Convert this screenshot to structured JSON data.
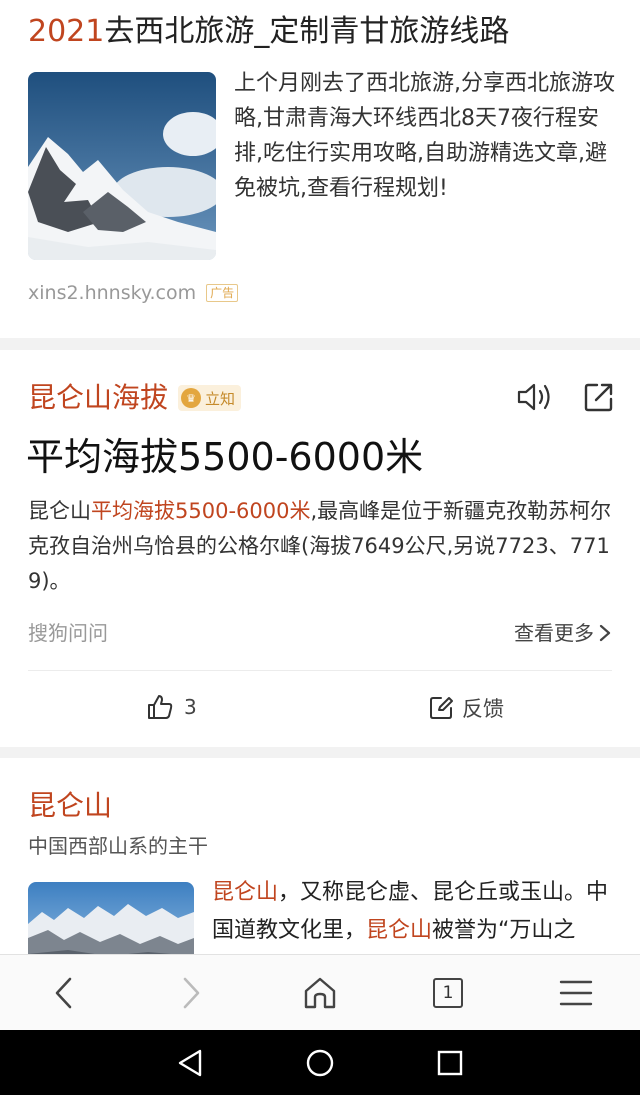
{
  "ad": {
    "title_prefix": "2021",
    "title_rest": "去西北旅游_定制青甘旅游线路",
    "description": "上个月刚去了西北旅游,分享西北旅游攻略,甘肃青海大环线西北8天7夜行程安排,吃住行实用攻略,自助游精选文章,避免被坑,查看行程规划!",
    "url": "xins2.hnnsky.com",
    "tag": "广告"
  },
  "answer": {
    "title": "昆仑山海拔",
    "badge_label": "立知",
    "headline": "平均海拔5500-6000米",
    "body_prefix": "昆仑山",
    "body_highlight": "平均海拔5500-6000米",
    "body_rest": ",最高峰是位于新疆克孜勒苏柯尔克孜自治州乌恰县的公格尔峰(海拔7649公尺,另说7723、7719)。",
    "source": "搜狗问问",
    "more_label": "查看更多",
    "like_count": "3",
    "feedback_label": "反馈"
  },
  "baike": {
    "title": "昆仑山",
    "subtitle": "中国西部山系的主干",
    "text_hl_1": "昆仑山",
    "text_part_1": "，又称昆仑虚、昆仑丘或玉山。中国道教文化里，",
    "text_hl_2": "昆仑山",
    "text_part_2": "被誉为“万山之"
  },
  "toolbar": {
    "tab_count": "1"
  },
  "colors": {
    "accent": "#c0451f",
    "badge": "#e3a63f"
  }
}
